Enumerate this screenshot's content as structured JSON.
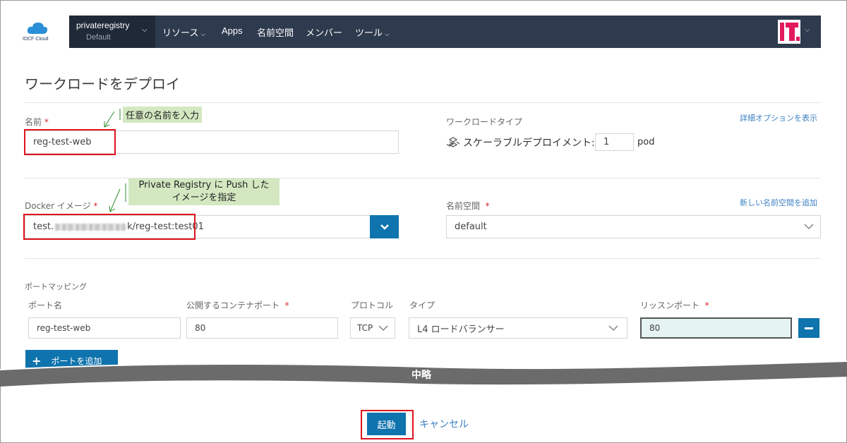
{
  "logo": {
    "text": "IDCF Cloud"
  },
  "navbar": {
    "project_name": "privateregistry",
    "project_sub": "Default",
    "items": [
      {
        "label": "リソース",
        "has_dropdown": true
      },
      {
        "label": "Apps",
        "has_dropdown": false
      },
      {
        "label": "名前空間",
        "has_dropdown": false
      },
      {
        "label": "メンバー",
        "has_dropdown": false
      },
      {
        "label": "ツール",
        "has_dropdown": true
      }
    ]
  },
  "page": {
    "title": "ワークロードをデプロイ"
  },
  "form": {
    "name_label": "名前",
    "name_value": "reg-test-web",
    "workload_type_label": "ワークロードタイプ",
    "advanced_link": "詳細オプションを表示",
    "workload_type_value": "スケーラブルデプロイメント:",
    "pod_count": "1",
    "pod_unit": "pod",
    "docker_label": "Docker イメージ",
    "docker_value_prefix": "test.",
    "docker_value_suffix": "k/reg-test:test01",
    "namespace_label": "名前空間",
    "namespace_link": "新しい名前空間を追加",
    "namespace_value": "default",
    "required_mark": "*"
  },
  "ports": {
    "section_label": "ポートマッピング",
    "headers": {
      "port_name": "ポート名",
      "container_port": "公開するコンテナポート",
      "protocol": "プロトコル",
      "type": "タイプ",
      "listen_port": "リッスンポート"
    },
    "row": {
      "port_name": "reg-test-web",
      "container_port": "80",
      "protocol": "TCP",
      "type": "L4 ロードバランサー",
      "listen_port": "80"
    },
    "add_button": "ポートを追加"
  },
  "annotations": {
    "name_note": "任意の名前を入力",
    "docker_note_line1": "Private Registry に Push した",
    "docker_note_line2": "イメージを指定"
  },
  "omitted_label": "中略",
  "actions": {
    "launch": "起動",
    "cancel": "キャンセル"
  },
  "colors": {
    "navbar": "#2e3a4d",
    "primary": "#0f73ad",
    "link": "#3b7fc2",
    "highlight_box": "#e0141e",
    "note_bg": "#d3e8c1"
  }
}
